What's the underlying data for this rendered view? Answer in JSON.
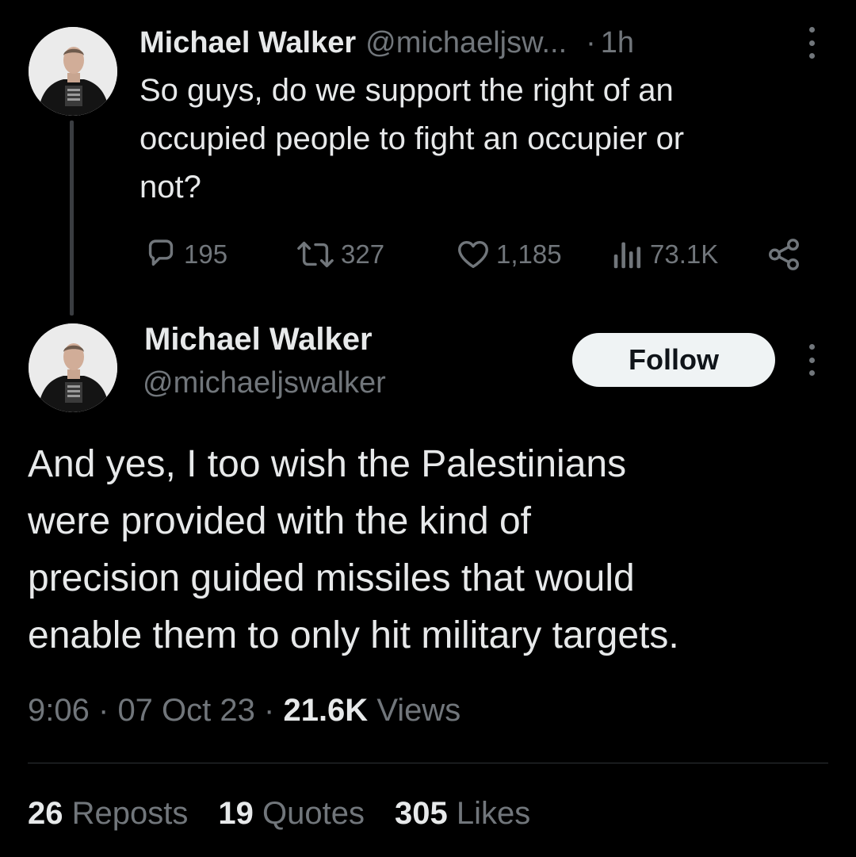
{
  "reply_tweet": {
    "author_name": "Michael Walker",
    "author_handle": "@michaeljsw...",
    "separator": "·",
    "time_ago": "1h",
    "text_lines": [
      "So guys, do we support the right of an",
      "occupied people to fight an occupier or",
      "not?"
    ],
    "actions": {
      "replies": "195",
      "reposts": "327",
      "likes": "1,185",
      "views": "73.1K"
    }
  },
  "main_tweet": {
    "author_name": "Michael Walker",
    "author_handle": "@michaeljswalker",
    "follow_label": "Follow",
    "text_lines": [
      "And yes, I too wish the Palestinians",
      "were provided with the kind of",
      "precision guided missiles that would",
      "enable them to only hit military targets."
    ],
    "time": "9:06",
    "date": "07 Oct 23",
    "meta_separator": "·",
    "views_count": "21.6K",
    "views_label": "Views",
    "stats": {
      "reposts_count": "26",
      "reposts_label": "Reposts",
      "quotes_count": "19",
      "quotes_label": "Quotes",
      "likes_count": "305",
      "likes_label": "Likes"
    }
  },
  "icons": {
    "reply": "speech-bubble-icon",
    "repost": "repost-arrows-icon",
    "like": "heart-icon",
    "views": "bar-chart-icon",
    "share": "share-nodes-icon",
    "more": "vertical-ellipsis-icon"
  },
  "colors": {
    "background": "#000000",
    "primary_text": "#e7e9ea",
    "secondary_text": "#71767b",
    "follow_button_bg": "#eff3f4",
    "follow_button_text": "#0f1419",
    "divider": "#2f3336"
  }
}
